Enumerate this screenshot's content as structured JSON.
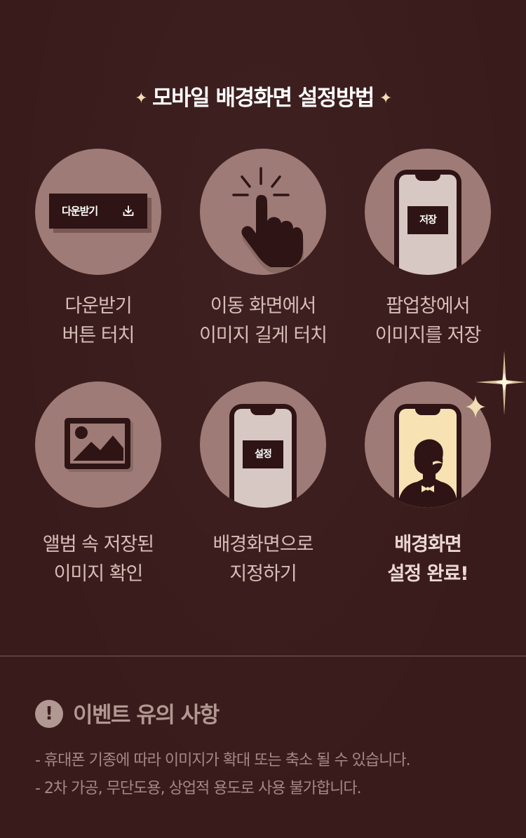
{
  "title": "모바일 배경화면 설정방법",
  "title_star": "✦",
  "steps": [
    {
      "line1": "다운받기",
      "line2": "버튼 터치",
      "button_label": "다운받기",
      "icon": "download-icon"
    },
    {
      "line1": "이동 화면에서",
      "line2": "이미지 길게 터치",
      "icon": "tap-hand-icon"
    },
    {
      "line1": "팝업창에서",
      "line2": "이미지를 저장",
      "tag": "저장",
      "icon": "phone-icon"
    },
    {
      "line1": "앨범 속 저장된",
      "line2": "이미지 확인",
      "icon": "image-icon"
    },
    {
      "line1": "배경화면으로",
      "line2": "지정하기",
      "tag": "설정",
      "icon": "phone-icon"
    },
    {
      "line1": "배경화면",
      "line2": "설정 완료!",
      "icon": "gentleman-silhouette-icon"
    }
  ],
  "notice": {
    "icon_glyph": "!",
    "title": "이벤트 유의 사항",
    "items": [
      "-  휴대폰 기종에 따라 이미지가 확대 또는 축소 될 수 있습니다.",
      "-  2차 가공, 무단도용, 상업적 용도로 사용 불가합니다."
    ]
  },
  "colors": {
    "background": "#3a1b1b",
    "circle": "#9e7b76",
    "dark": "#2e1414",
    "accent": "#f1ddb2",
    "screen_done": "#f6e2b3"
  }
}
